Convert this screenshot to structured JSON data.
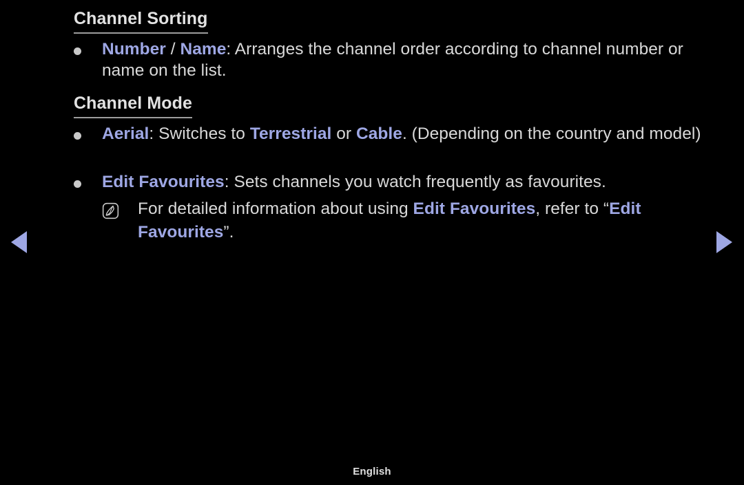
{
  "page": {
    "background_color": "#000000",
    "body_text_color": "#D9D9D9",
    "highlight_color": "#9EA7E4",
    "heading_color": "#E2E2E2",
    "bullet_color": "#C9C9C9",
    "rule_color": "#9D9D9D"
  },
  "sections": [
    {
      "heading": "Channel Sorting",
      "items": [
        {
          "bullet": "●",
          "segments": [
            {
              "text": "Number",
              "style": "highlight"
            },
            {
              "text": " / ",
              "style": "normal"
            },
            {
              "text": "Name",
              "style": "highlight"
            },
            {
              "text": ": Arranges the channel order according to channel number or name on the list.",
              "style": "normal"
            }
          ]
        }
      ]
    },
    {
      "heading": "Channel Mode",
      "items": [
        {
          "bullet": "●",
          "segments": [
            {
              "text": "Aerial",
              "style": "highlight"
            },
            {
              "text": ": Switches to ",
              "style": "normal"
            },
            {
              "text": "Terrestrial",
              "style": "highlight"
            },
            {
              "text": " or ",
              "style": "normal"
            },
            {
              "text": "Cable",
              "style": "highlight"
            },
            {
              "text": ". (Depending on the country and model)",
              "style": "normal"
            }
          ]
        },
        {
          "bullet": "●",
          "segments": [
            {
              "text": "Edit Favourites",
              "style": "highlight"
            },
            {
              "text": ": Sets channels you watch frequently as favourites.",
              "style": "normal"
            }
          ]
        }
      ],
      "note": {
        "icon": "note-pen-icon",
        "segments": [
          {
            "text": "For detailed information about using ",
            "style": "normal"
          },
          {
            "text": "Edit Favourites",
            "style": "highlight"
          },
          {
            "text": ", refer to “",
            "style": "normal"
          },
          {
            "text": "Edit Favourites",
            "style": "highlight"
          },
          {
            "text": "”.",
            "style": "normal"
          }
        ]
      }
    }
  ],
  "text": {
    "heading_channel_sorting": "Channel Sorting",
    "heading_channel_mode": "Channel Mode",
    "item_number_name_prefix_1": "Number",
    "item_number_name_sep": " / ",
    "item_number_name_prefix_2": "Name",
    "item_number_name_body": ": Arranges the channel order according to channel number or name on the list.",
    "item_aerial_prefix": "Aerial",
    "item_aerial_body_1": ": Switches to ",
    "item_aerial_terrestrial": "Terrestrial",
    "item_aerial_body_2": " or ",
    "item_aerial_cable": "Cable",
    "item_aerial_body_3": ". (Depending on the country and model)",
    "item_editfav_prefix": "Edit Favourites",
    "item_editfav_body": ": Sets channels you watch frequently as favourites.",
    "note_body_1": "For detailed information about using ",
    "note_editfav_1": "Edit Favourites",
    "note_body_2": ", refer to “",
    "note_editfav_2": "Edit Favourites",
    "note_body_3": "”."
  },
  "navigation": {
    "prev_label": "◀",
    "next_label": "▶",
    "prev_name": "previous-page-arrow",
    "next_name": "next-page-arrow"
  },
  "footer": {
    "language": "English"
  }
}
